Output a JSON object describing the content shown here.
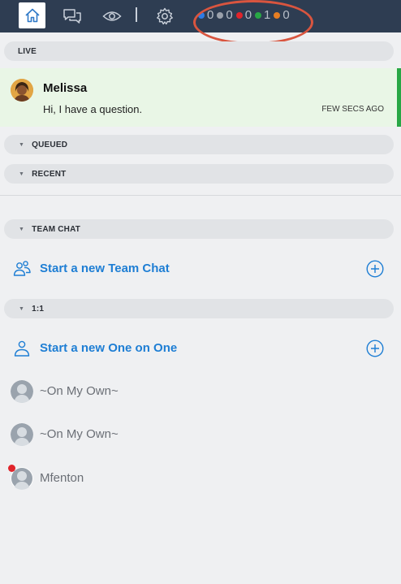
{
  "topbar": {
    "icons": [
      "home-icon",
      "chat-bubbles-icon",
      "eye-icon",
      "gear-icon"
    ],
    "status_counts": [
      {
        "color": "#2d7be5",
        "count": "0"
      },
      {
        "color": "#9aa1ab",
        "count": "0"
      },
      {
        "color": "#e0242b",
        "count": "0"
      },
      {
        "color": "#28a745",
        "count": "1"
      },
      {
        "color": "#e67e22",
        "count": "0"
      }
    ]
  },
  "sections": {
    "live": "LIVE",
    "queued": "QUEUED",
    "recent": "RECENT",
    "team_chat": "TEAM CHAT",
    "one_on_one": "1:1"
  },
  "live_chat": {
    "name": "Melissa",
    "message": "Hi, I have a question.",
    "time": "FEW SECS AGO",
    "accent": "#28a745"
  },
  "team_chat": {
    "start_label": "Start a new Team Chat"
  },
  "one_on_one": {
    "start_label": "Start a new One on One",
    "contacts": [
      {
        "name": "~On My Own~",
        "unread": false
      },
      {
        "name": "~On My Own~",
        "unread": false
      },
      {
        "name": "Mfenton",
        "unread": true
      }
    ]
  },
  "colors": {
    "topbar": "#2e3d52",
    "link": "#1e7ed4",
    "highlight": "#d9553f"
  }
}
